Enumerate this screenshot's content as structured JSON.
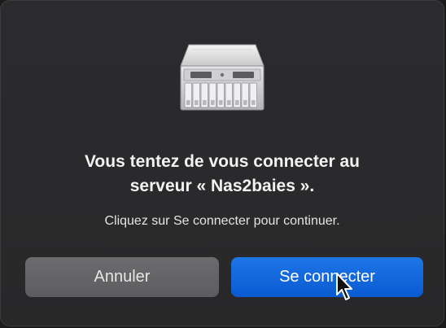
{
  "dialog": {
    "icon": "server-icon",
    "title_line1": "Vous tentez de vous connecter au",
    "title_line2": "serveur « Nas2baies ».",
    "message": "Cliquez sur Se connecter pour continuer."
  },
  "buttons": {
    "cancel_label": "Annuler",
    "connect_label": "Se connecter"
  },
  "colors": {
    "accent": "#0a5ad1",
    "background": "#2a2a2c"
  }
}
